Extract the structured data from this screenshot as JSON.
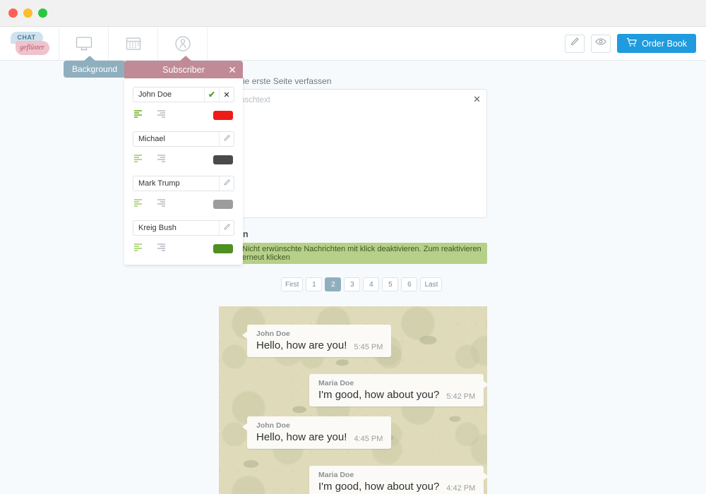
{
  "window": {
    "dots": [
      "close",
      "minimize",
      "zoom"
    ]
  },
  "branding": {
    "logo_top": "CHAT",
    "logo_bottom": "geflüster"
  },
  "nav": {
    "items": [
      {
        "icon": "monitor-icon",
        "name": "background"
      },
      {
        "icon": "calendar-icon",
        "name": "calendar"
      },
      {
        "icon": "user-circle-icon",
        "name": "subscriber"
      }
    ],
    "tooltip_background": "Background"
  },
  "toolbar": {
    "edit_icon": "pencil-icon",
    "preview_icon": "eye-icon",
    "order_label": "Order Book",
    "order_icon": "cart-icon",
    "order_color": "#1f9bde"
  },
  "subscriber_panel": {
    "title": "Subscriber",
    "header_color": "#c08a96",
    "close_label": "✕",
    "rows": [
      {
        "name": "John Doe",
        "editing": true,
        "confirm_icon": "check-icon",
        "cancel_icon": "x-icon",
        "align_left_icon": "align-left-icon",
        "align_right_icon": "align-right-icon",
        "color": "#ee1c16"
      },
      {
        "name": "Michael",
        "editing": false,
        "edit_icon": "pencil-icon",
        "align_left_icon": "align-left-icon",
        "align_right_icon": "align-right-icon",
        "color": "#4a4a4a"
      },
      {
        "name": "Mark Trump",
        "editing": false,
        "edit_icon": "pencil-icon",
        "align_left_icon": "align-left-icon",
        "align_right_icon": "align-right-icon",
        "color": "#9d9d9d"
      },
      {
        "name": "Kreig Bush",
        "editing": false,
        "edit_icon": "pencil-icon",
        "align_left_icon": "align-left-icon",
        "align_right_icon": "align-right-icon",
        "color": "#4f9021"
      }
    ]
  },
  "form": {
    "label": "g für die erste Seite verfassen",
    "textarea_placeholder": "Wunschtext",
    "textarea_value": "",
    "clear_icon": "x-icon"
  },
  "chat_section": {
    "title": "rbeiten",
    "alert_icon": "info-icon",
    "alert_text": "Nicht erwünschte Nachrichten mit klick deaktivieren. Zum reaktivieren erneut klicken",
    "alert_color": "#b6d089"
  },
  "pagination": {
    "first_label": "First",
    "last_label": "Last",
    "pages": [
      "1",
      "2",
      "3",
      "4",
      "5",
      "6"
    ],
    "active": "2",
    "active_color": "#8fafbf"
  },
  "chat": {
    "messages": [
      {
        "author": "John Doe",
        "text": "Hello, how are you!",
        "time": "5:45 PM",
        "side": "left"
      },
      {
        "author": "Maria Doe",
        "text": "I'm good, how about you?",
        "time": "5:42 PM",
        "side": "right"
      },
      {
        "author": "John Doe",
        "text": "Hello, how are you!",
        "time": "4:45 PM",
        "side": "left"
      },
      {
        "author": "Maria Doe",
        "text": "I'm good, how about you?",
        "time": "4:42 PM",
        "side": "right"
      }
    ]
  }
}
